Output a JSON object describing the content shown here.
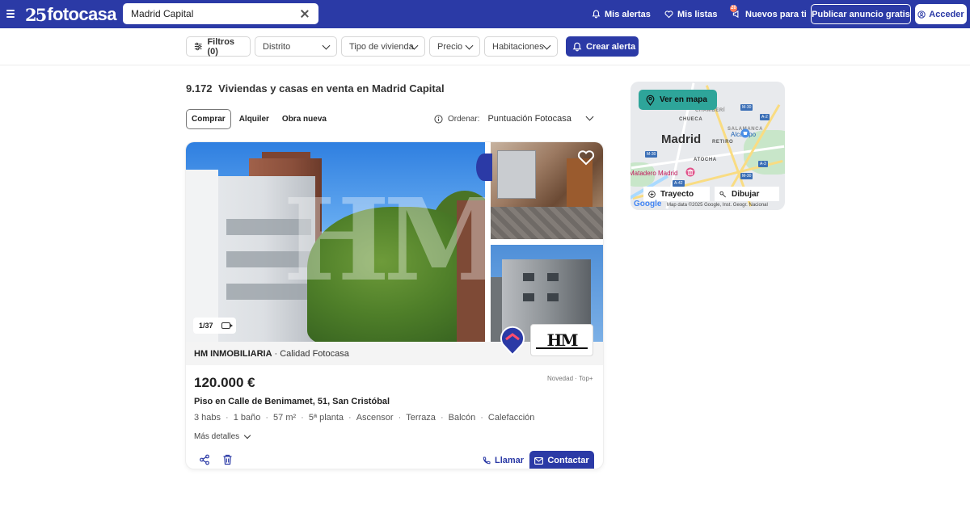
{
  "header": {
    "logo_mark": "25",
    "logo_text": "fotocasa",
    "search": {
      "value": "Madrid Capital",
      "placeholder": ""
    },
    "nav": {
      "alertas": "Mis alertas",
      "listas": "Mis listas",
      "nuevos": "Nuevos para ti",
      "nuevos_badge": "20"
    },
    "publicar": "Publicar anuncio gratis",
    "acceder": "Acceder"
  },
  "filters": {
    "filtros": "Filtros (0)",
    "distrito": "Distrito",
    "tipo": "Tipo de vivienda",
    "precio": "Precio",
    "habitaciones": "Habitaciones",
    "crear_alerta": "Crear alerta"
  },
  "results": {
    "count": "9.172",
    "title": "Viviendas y casas en venta en Madrid Capital",
    "tabs": [
      "Comprar",
      "Alquiler",
      "Obra nueva"
    ],
    "active_tab": "Comprar",
    "sort_label": "Ordenar:",
    "sort_value": "Puntuación Fotocasa"
  },
  "listing": {
    "photo_counter": "1/37",
    "watermark": "HM",
    "agency_name": "HM INMOBILIARIA",
    "agency_separator": "·",
    "agency_quality": "Calidad Fotocasa",
    "agency_logo_text": "HM",
    "price": "120.000 €",
    "tags": "Novedad · Top+",
    "title": "Piso en Calle de Benimamet, 51, San Cristóbal",
    "features": [
      "3 habs",
      "1 baño",
      "57 m²",
      "5ª planta",
      "Ascensor",
      "Terraza",
      "Balcón",
      "Calefacción"
    ],
    "more_details": "Más detalles",
    "call": "Llamar",
    "contact": "Contactar"
  },
  "map": {
    "ver_en_mapa": "Ver en mapa",
    "city": "Madrid",
    "labels": {
      "chueca": "CHUECA",
      "retiro": "RETIRO",
      "atocha": "ATOCHA",
      "chamberi": "CHAMBERÍ",
      "salamanca": "SALAMANCA"
    },
    "places": {
      "matadero": "Matadero Madrid",
      "alcampo": "Alcampo"
    },
    "shields": [
      "M-30",
      "M-30",
      "A-2",
      "A-3",
      "A-42",
      "M-30"
    ],
    "trayecto": "Trayecto",
    "dibujar": "Dibujar",
    "google": "Google",
    "attribution": "Map data ©2025 Google, Inst. Geogr. Nacional"
  },
  "colors": {
    "brand": "#2b3aa6",
    "map_button": "#2ea59a",
    "agency_strip": "#f4f4f4"
  }
}
